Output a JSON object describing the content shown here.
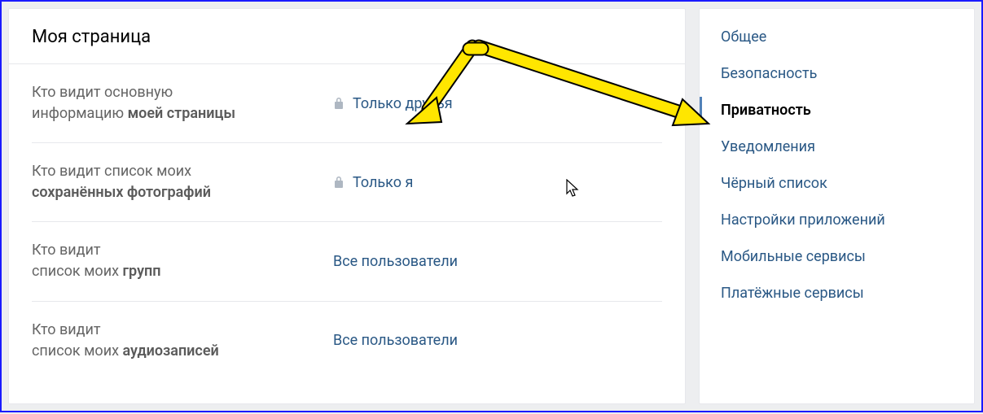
{
  "section": {
    "title": "Моя страница"
  },
  "rows": [
    {
      "label_prefix": "Кто видит основную информацию ",
      "label_bold": "моей страницы",
      "value": "Только друзья",
      "locked": true
    },
    {
      "label_prefix": "Кто видит список моих ",
      "label_bold": "сохранённых фотографий",
      "value": "Только я",
      "locked": true
    },
    {
      "label_prefix": "Кто видит список моих ",
      "label_bold": "групп",
      "value": "Все пользователи",
      "locked": false
    },
    {
      "label_prefix": "Кто видит список моих ",
      "label_bold": "аудиозаписей",
      "value": "Все пользователи",
      "locked": false
    }
  ],
  "row0": {
    "label_prefix": "Кто видит основную\nинформацию ",
    "label_bold": "моей страницы",
    "value": "Только друзья"
  },
  "row1": {
    "label_prefix": "Кто видит список моих\n",
    "label_bold": "сохранённых фотографий",
    "value": "Только я"
  },
  "row2": {
    "label_prefix": "Кто видит\nсписок моих ",
    "label_bold": "групп",
    "value": "Все пользователи"
  },
  "row3": {
    "label_prefix": "Кто видит\nсписок моих ",
    "label_bold": "аудиозаписей",
    "value": "Все пользователи"
  },
  "sidebar": {
    "items": [
      {
        "label": "Общее",
        "active": false
      },
      {
        "label": "Безопасность",
        "active": false
      },
      {
        "label": "Приватность",
        "active": true
      },
      {
        "label": "Уведомления",
        "active": false
      },
      {
        "label": "Чёрный список",
        "active": false
      },
      {
        "label": "Настройки приложений",
        "active": false
      },
      {
        "label": "Мобильные сервисы",
        "active": false
      },
      {
        "label": "Платёжные сервисы",
        "active": false
      }
    ]
  },
  "annotation": {
    "arrow_color": "#ffe600",
    "arrow_stroke": "#000"
  }
}
